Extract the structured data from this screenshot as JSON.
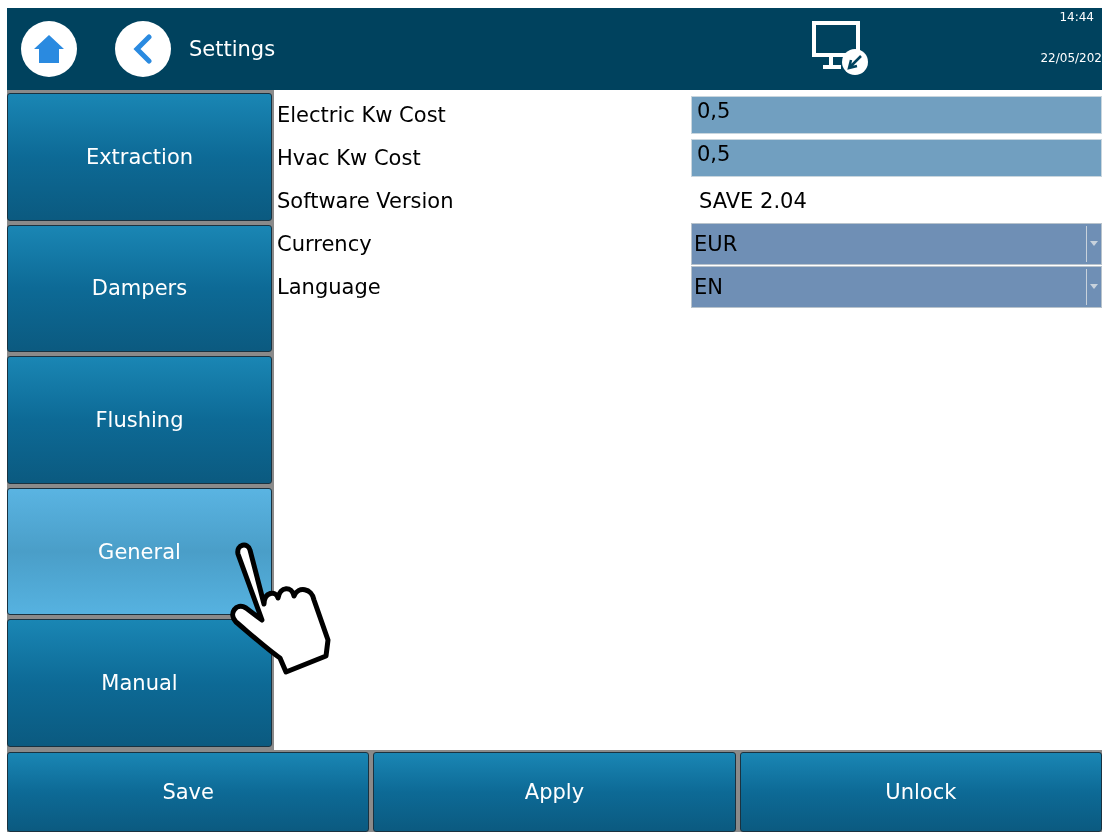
{
  "header": {
    "title": "Settings",
    "time": "14:44",
    "date": "22/05/202"
  },
  "sidebar": {
    "items": [
      {
        "label": "Extraction",
        "selected": false
      },
      {
        "label": "Dampers",
        "selected": false
      },
      {
        "label": "Flushing",
        "selected": false
      },
      {
        "label": "General",
        "selected": true
      },
      {
        "label": "Manual",
        "selected": false
      }
    ]
  },
  "settings": [
    {
      "label": "Electric Kw Cost",
      "kind": "input",
      "value": "0,5"
    },
    {
      "label": "Hvac Kw Cost",
      "kind": "input",
      "value": "0,5"
    },
    {
      "label": "Software Version",
      "kind": "text",
      "value": "SAVE 2.04"
    },
    {
      "label": "Currency",
      "kind": "dropdown",
      "value": "EUR"
    },
    {
      "label": "Language",
      "kind": "dropdown",
      "value": "EN"
    }
  ],
  "buttons": [
    "Save",
    "Apply",
    "Unlock"
  ]
}
